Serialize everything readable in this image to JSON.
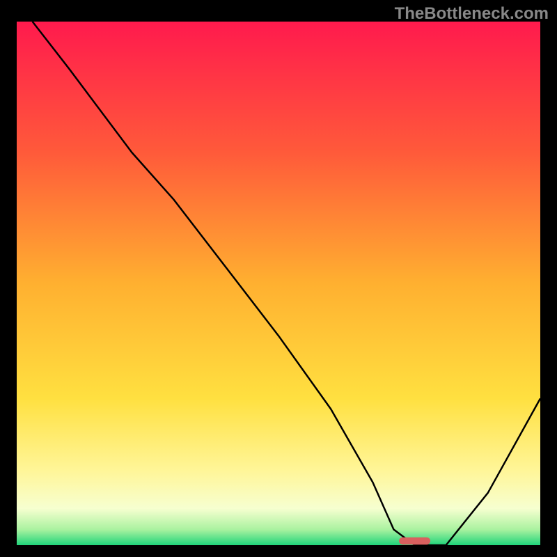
{
  "watermark": "TheBottleneck.com",
  "chart_data": {
    "type": "line",
    "title": "",
    "xlabel": "",
    "ylabel": "",
    "xrange": [
      0,
      100
    ],
    "yrange": [
      0,
      100
    ],
    "series": [
      {
        "name": "curve",
        "x": [
          3,
          10,
          22,
          30,
          40,
          50,
          60,
          68,
          72,
          76,
          82,
          90,
          100
        ],
        "y": [
          100,
          91,
          75,
          66,
          53,
          40,
          26,
          12,
          3,
          0,
          0,
          10,
          28
        ]
      }
    ],
    "gradient_stops": [
      {
        "offset": 0,
        "color": "#ff1a4d"
      },
      {
        "offset": 25,
        "color": "#ff5a3a"
      },
      {
        "offset": 50,
        "color": "#ffb030"
      },
      {
        "offset": 72,
        "color": "#ffe040"
      },
      {
        "offset": 86,
        "color": "#fff69a"
      },
      {
        "offset": 93,
        "color": "#f6ffd0"
      },
      {
        "offset": 97,
        "color": "#aaf2a0"
      },
      {
        "offset": 100,
        "color": "#1fd47a"
      }
    ],
    "marker": {
      "x": 76,
      "y": 0.8,
      "w": 6,
      "h": 1.4,
      "color": "#d9605f"
    }
  }
}
